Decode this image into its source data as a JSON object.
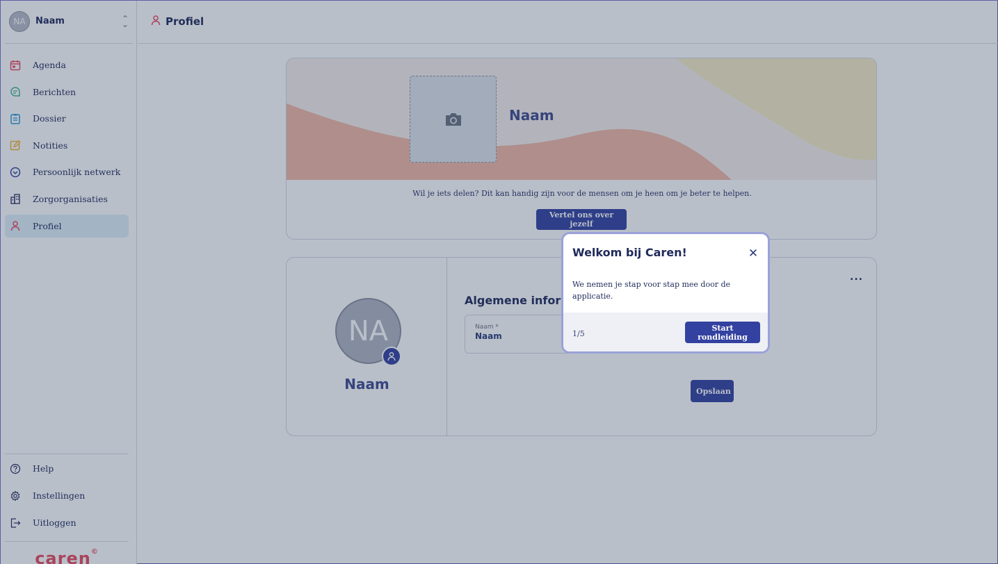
{
  "user": {
    "initials": "NA",
    "name": "Naam"
  },
  "nav": {
    "items": [
      {
        "label": "Agenda",
        "icon": "calendar-icon",
        "color": "#e84a5f"
      },
      {
        "label": "Berichten",
        "icon": "chat-icon",
        "color": "#3fb68b"
      },
      {
        "label": "Dossier",
        "icon": "clipboard-icon",
        "color": "#2f9bd6"
      },
      {
        "label": "Notities",
        "icon": "edit-icon",
        "color": "#f2b134"
      },
      {
        "label": "Persoonlijk netwerk",
        "icon": "network-icon",
        "color": "#3341a0"
      },
      {
        "label": "Zorgorganisaties",
        "icon": "building-icon",
        "color": "#1f2a5a"
      },
      {
        "label": "Profiel",
        "icon": "person-icon",
        "color": "#e84a5f"
      }
    ],
    "bottom": [
      {
        "label": "Help",
        "icon": "help-icon"
      },
      {
        "label": "Instellingen",
        "icon": "gear-icon"
      },
      {
        "label": "Uitloggen",
        "icon": "logout-icon"
      }
    ]
  },
  "logo": {
    "text": "caren",
    "mark": "©"
  },
  "topbar": {
    "title": "Profiel"
  },
  "hero": {
    "name": "Naam",
    "text": "Wil je iets delen? Dit kan handig zijn voor de mensen om je heen om je beter te helpen.",
    "button": "Vertel ons over jezelf"
  },
  "profile": {
    "initials": "NA",
    "name": "Naam",
    "more": "...",
    "section_title": "Algemene informatie",
    "field_label": "Naam *",
    "field_value": "Naam",
    "save": "Opslaan"
  },
  "popover": {
    "title": "Welkom bij Caren!",
    "close": "✕",
    "body": "We nemen je stap voor stap mee door de applicatie.",
    "step": "1/5",
    "button": "Start rondleiding"
  },
  "colors": {
    "primary": "#3341a0",
    "brand": "#e84a5f",
    "heading": "#3e4b8f",
    "active_nav": "#dfeff8",
    "overlay": "rgba(36, 56, 86, 0.32)"
  }
}
